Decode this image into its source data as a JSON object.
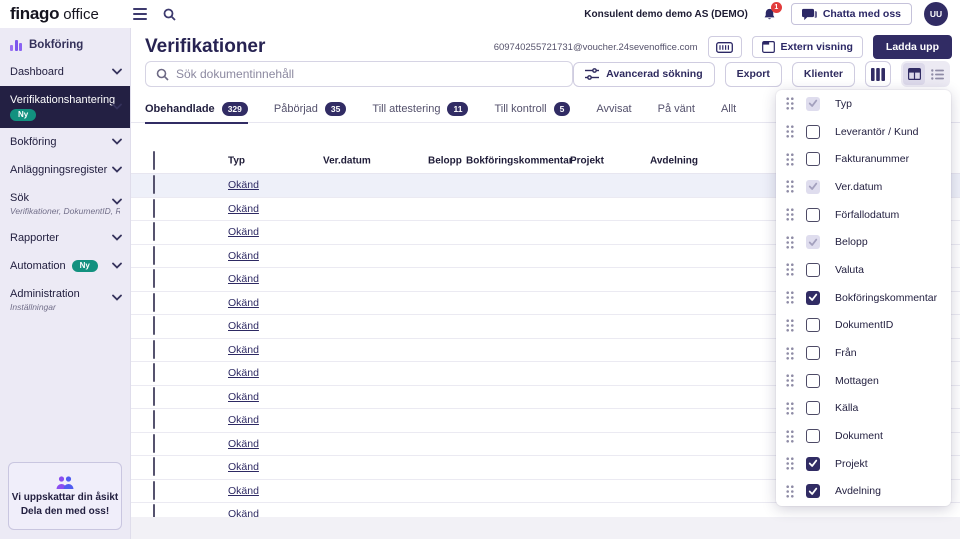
{
  "topbar": {
    "logo": "finago",
    "logo_suffix": "office",
    "account": "Konsulent demo demo AS (DEMO)",
    "notification_count": "1",
    "chat_button": "Chatta med oss",
    "avatar_initials": "UU"
  },
  "sidebar": {
    "section": "Bokföring",
    "items": [
      {
        "label": "Dashboard"
      },
      {
        "label": "Verifikationshantering",
        "badge": "Ny",
        "badge_position": "below",
        "active": true
      },
      {
        "label": "Bokföring"
      },
      {
        "label": "Anläggningsregister"
      },
      {
        "label": "Sök",
        "sublabel": "Verifikationer, DokumentID, R...",
        "chevron": true
      },
      {
        "label": "Rapporter"
      },
      {
        "label": "Automation",
        "badge": "Ny",
        "badge_position": "inline"
      },
      {
        "label": "Administration",
        "sublabel": "Inställningar",
        "chevron": true
      }
    ],
    "feedback": {
      "line1": "Vi uppskattar din åsikt",
      "line2": "Dela den med oss!"
    }
  },
  "header": {
    "title": "Verifikationer",
    "voucher_email": "609740255721731@voucher.24sevenoffice.com",
    "extern_button": "Extern visning",
    "upload_button": "Ladda upp"
  },
  "toolbar": {
    "search_placeholder": "Sök dokumentinnehåll",
    "advanced_button": "Avancerad sökning",
    "export_button": "Export",
    "clients_button": "Klienter"
  },
  "tabs": [
    {
      "label": "Obehandlade",
      "count": "329",
      "active": true
    },
    {
      "label": "Påbörjad",
      "count": "35"
    },
    {
      "label": "Till attestering",
      "count": "11"
    },
    {
      "label": "Till kontroll",
      "count": "5"
    },
    {
      "label": "Avvisat"
    },
    {
      "label": "På vänt"
    },
    {
      "label": "Allt"
    }
  ],
  "table": {
    "headers": [
      "Typ",
      "Ver.datum",
      "Belopp",
      "Bokföringskommentar",
      "Projekt",
      "Avdelning"
    ],
    "rows": [
      "Okänd",
      "Okänd",
      "Okänd",
      "Okänd",
      "Okänd",
      "Okänd",
      "Okänd",
      "Okänd",
      "Okänd",
      "Okänd",
      "Okänd",
      "Okänd",
      "Okänd",
      "Okänd",
      "Okänd"
    ]
  },
  "column_picker": {
    "items": [
      {
        "label": "Typ",
        "state": "locked"
      },
      {
        "label": "Leverantör / Kund",
        "state": "unchecked"
      },
      {
        "label": "Fakturanummer",
        "state": "unchecked"
      },
      {
        "label": "Ver.datum",
        "state": "locked"
      },
      {
        "label": "Förfallodatum",
        "state": "unchecked"
      },
      {
        "label": "Belopp",
        "state": "locked"
      },
      {
        "label": "Valuta",
        "state": "unchecked"
      },
      {
        "label": "Bokföringskommentar",
        "state": "checked"
      },
      {
        "label": "DokumentID",
        "state": "unchecked"
      },
      {
        "label": "Från",
        "state": "unchecked"
      },
      {
        "label": "Mottagen",
        "state": "unchecked"
      },
      {
        "label": "Källa",
        "state": "unchecked"
      },
      {
        "label": "Dokument",
        "state": "unchecked"
      },
      {
        "label": "Projekt",
        "state": "checked"
      },
      {
        "label": "Avdelning",
        "state": "checked"
      }
    ]
  },
  "icons": {
    "menu-icon": "hamburger",
    "search-icon": "magnifier",
    "bell-icon": "notifications",
    "chat-icon": "speech-bubble",
    "bar-chart-icon": "accounting",
    "chevron-down-icon": "expand",
    "feedback-icon": "people",
    "keyboard-icon": "voucher-keyboard",
    "external-window-icon": "external-view",
    "sliders-icon": "advanced-search",
    "columns-icon": "column-picker",
    "table-view-icon": "grid-view",
    "list-view-icon": "list-view",
    "grip-icon": "drag-handle",
    "checkmark-icon": "checked"
  },
  "colors": {
    "primary": "#312c64",
    "sidebar_active": "#232043",
    "teal_badge": "#12917f",
    "notification_red": "#e23c3c",
    "sidebar_bg": "#eceaf5",
    "row_highlight": "#eef0f9"
  }
}
